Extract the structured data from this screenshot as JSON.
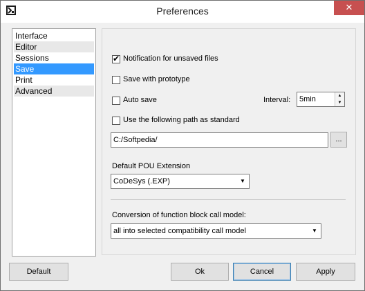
{
  "window": {
    "title": "Preferences",
    "close_glyph": "✕",
    "icon": "app-icon"
  },
  "nav": {
    "items": [
      {
        "label": "Interface",
        "selected": false
      },
      {
        "label": "Editor",
        "selected": false
      },
      {
        "label": "Sessions",
        "selected": false
      },
      {
        "label": "Save",
        "selected": true
      },
      {
        "label": "Print",
        "selected": false
      },
      {
        "label": "Advanced",
        "selected": false
      }
    ]
  },
  "save_panel": {
    "notify_unsaved": {
      "label": "Notification for unsaved files",
      "checked": true
    },
    "save_with_prototype": {
      "label": "Save with prototype",
      "checked": false
    },
    "auto_save": {
      "label": "Auto save",
      "checked": false
    },
    "interval": {
      "label": "Interval:",
      "value": "5min"
    },
    "use_path": {
      "label": "Use the following path as standard",
      "checked": false
    },
    "path": {
      "value": "C:/Softpedia/",
      "browse_label": "..."
    },
    "pou_extension": {
      "label": "Default POU Extension",
      "value": "CoDeSys (.EXP)"
    },
    "conversion": {
      "label": "Conversion of function block call model:",
      "value": "all into selected compatibility call model"
    }
  },
  "buttons": {
    "default": "Default",
    "ok": "Ok",
    "cancel": "Cancel",
    "apply": "Apply"
  },
  "colors": {
    "selection": "#3399ff",
    "close_button": "#c75050"
  }
}
